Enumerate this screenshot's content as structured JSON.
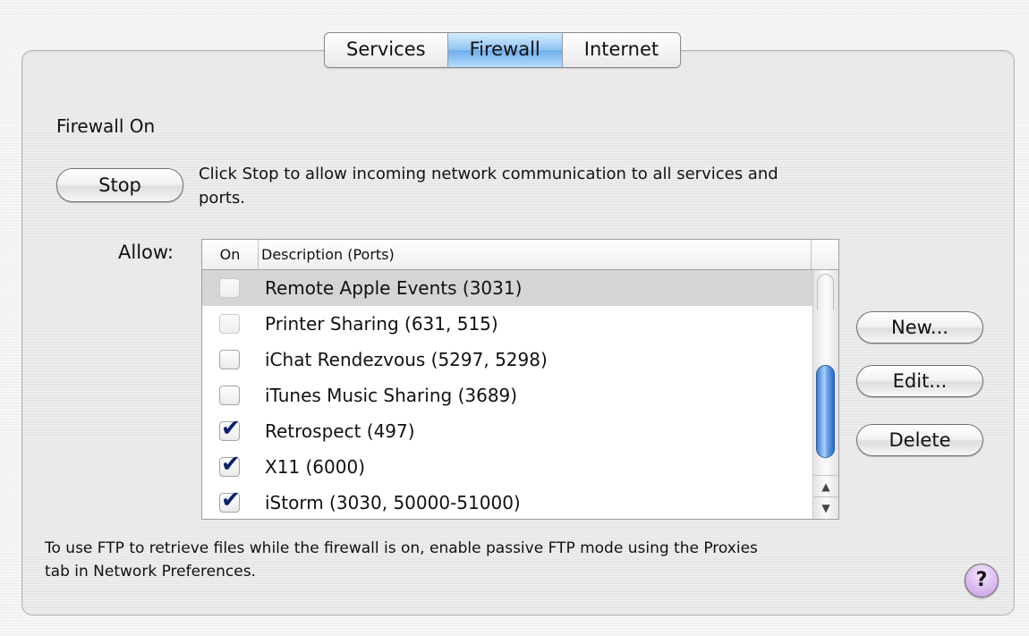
{
  "tabs": [
    {
      "label": "Services",
      "selected": false
    },
    {
      "label": "Firewall",
      "selected": true
    },
    {
      "label": "Internet",
      "selected": false
    }
  ],
  "status": {
    "title": "Firewall On",
    "stop_label": "Stop",
    "stop_description_line1": "Click Stop to allow incoming network communication to all services and",
    "stop_description_line2": "ports."
  },
  "allow_label": "Allow:",
  "table": {
    "columns": {
      "on": "On",
      "description": "Description (Ports)"
    },
    "rows": [
      {
        "description": "Remote Apple Events (3031)",
        "checked": false,
        "enabled": false,
        "selected": true
      },
      {
        "description": "Printer Sharing (631, 515)",
        "checked": false,
        "enabled": false,
        "selected": false
      },
      {
        "description": "iChat Rendezvous (5297, 5298)",
        "checked": false,
        "enabled": true,
        "selected": false
      },
      {
        "description": "iTunes Music Sharing (3689)",
        "checked": false,
        "enabled": true,
        "selected": false
      },
      {
        "description": "Retrospect (497)",
        "checked": true,
        "enabled": true,
        "selected": false
      },
      {
        "description": "X11 (6000)",
        "checked": true,
        "enabled": true,
        "selected": false
      },
      {
        "description": "iStorm (3030, 50000-51000)",
        "checked": true,
        "enabled": true,
        "selected": false
      }
    ]
  },
  "buttons": {
    "new": "New...",
    "edit": "Edit...",
    "delete": "Delete"
  },
  "footer": {
    "line1": "To use FTP to retrieve files while the firewall is on, enable passive FTP mode using the Proxies",
    "line2": "tab in Network Preferences."
  },
  "help_label": "?",
  "icons": {
    "checkmark": "checkmark-icon",
    "scroll_up": "scroll-up-arrow-icon",
    "scroll_down": "scroll-down-arrow-icon"
  },
  "colors": {
    "selected_tab": "#8ec3f2",
    "scroll_thumb": "#3b7bd6",
    "checkmark": "#0c1f6e",
    "help_button": "#d9b8f0"
  }
}
